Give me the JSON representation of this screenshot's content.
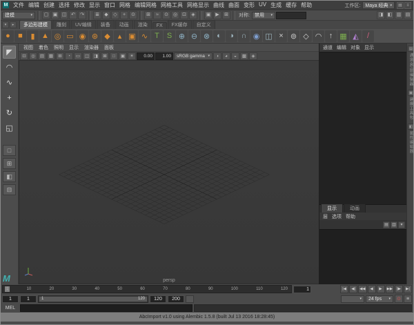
{
  "glyphs": {
    "caret": "▾"
  },
  "window": {
    "app_icon": "M",
    "workspace_label": "工作区:",
    "workspace_value": "Maya 经典",
    "right_icons": [
      {
        "name": "workspace-docking-icon",
        "glyph": "▤"
      },
      {
        "name": "workspace-menu-icon",
        "glyph": "≡"
      }
    ]
  },
  "menubar": {
    "items": [
      {
        "label": "文件"
      },
      {
        "label": "编辑"
      },
      {
        "label": "创建"
      },
      {
        "label": "选择"
      },
      {
        "label": "修改"
      },
      {
        "label": "显示"
      },
      {
        "label": "窗口"
      },
      {
        "label": "网格"
      },
      {
        "label": "编辑网格"
      },
      {
        "label": "网格工具"
      },
      {
        "label": "网格显示"
      },
      {
        "label": "曲线"
      },
      {
        "label": "曲面"
      },
      {
        "label": "变形"
      },
      {
        "label": "UV"
      },
      {
        "label": "生成"
      },
      {
        "label": "缓存"
      },
      {
        "label": "帮助"
      }
    ]
  },
  "statusline": {
    "menuset": "建模",
    "file_icons": [
      {
        "name": "new-scene-icon",
        "glyph": "▢"
      },
      {
        "name": "open-scene-icon",
        "glyph": "▣"
      },
      {
        "name": "save-scene-icon",
        "glyph": "◫"
      }
    ],
    "history_icons": [
      {
        "name": "undo-icon",
        "glyph": "↶"
      },
      {
        "name": "redo-icon",
        "glyph": "↷"
      }
    ],
    "select_icons": [
      {
        "name": "select-hierarchy-icon",
        "glyph": "≣"
      },
      {
        "name": "select-object-icon",
        "glyph": "◆"
      },
      {
        "name": "select-component-icon",
        "glyph": "◇"
      },
      {
        "name": "select-mask-handles-icon",
        "glyph": "+"
      },
      {
        "name": "select-mask-points-icon",
        "glyph": "⊙"
      }
    ],
    "snap_icons": [
      {
        "name": "snap-grid-icon",
        "glyph": "⊞"
      },
      {
        "name": "snap-curve-icon",
        "glyph": "≈"
      },
      {
        "name": "snap-point-icon",
        "glyph": "⊙"
      },
      {
        "name": "snap-projected-center-icon",
        "glyph": "◎"
      },
      {
        "name": "snap-view-plane-icon",
        "glyph": "⊡"
      },
      {
        "name": "make-live-icon",
        "glyph": "◈"
      }
    ],
    "symmetry_label": "对称:",
    "symmetry_value": "禁用",
    "input_line_value": "",
    "render_icons": [
      {
        "name": "render-frame-icon",
        "glyph": "▣"
      },
      {
        "name": "ipr-render-icon",
        "glyph": "▶"
      },
      {
        "name": "render-settings-icon",
        "glyph": "⊞"
      }
    ],
    "panel_toggle_icons": [
      {
        "name": "toggle-attribute-editor-icon",
        "glyph": "◨"
      },
      {
        "name": "toggle-tool-settings-icon",
        "glyph": "◧"
      },
      {
        "name": "toggle-channel-box-icon",
        "glyph": "▥"
      },
      {
        "name": "toggle-outliner-icon",
        "glyph": "▤"
      }
    ]
  },
  "shelf": {
    "controls": [
      {
        "name": "shelf-menu-icon",
        "glyph": "▾"
      },
      {
        "name": "shelf-tabs-icon",
        "glyph": "▸"
      }
    ],
    "tabs": [
      {
        "label": "多边形建模",
        "active": true
      },
      {
        "label": "雕刻"
      },
      {
        "label": "UV编辑"
      },
      {
        "label": "装备"
      },
      {
        "label": "动画"
      },
      {
        "label": "渲染"
      },
      {
        "label": "FX"
      },
      {
        "label": "FX缓存"
      },
      {
        "label": "自定义"
      }
    ],
    "icons": [
      {
        "name": "shelf-poly-sphere",
        "glyph": "●",
        "color": "#d98c33"
      },
      {
        "name": "shelf-poly-cube",
        "glyph": "■",
        "color": "#d98c33"
      },
      {
        "name": "shelf-poly-cylinder",
        "glyph": "▮",
        "color": "#d98c33"
      },
      {
        "name": "shelf-poly-cone",
        "glyph": "▲",
        "color": "#d98c33"
      },
      {
        "name": "shelf-poly-torus",
        "glyph": "◎",
        "color": "#d98c33"
      },
      {
        "name": "shelf-poly-plane",
        "glyph": "▭",
        "color": "#d98c33"
      },
      {
        "name": "shelf-poly-disc",
        "glyph": "◉",
        "color": "#d98c33"
      },
      {
        "name": "shelf-poly-gear",
        "glyph": "⊛",
        "color": "#d98c33"
      },
      {
        "name": "shelf-poly-platonic",
        "glyph": "◆",
        "color": "#d98c33"
      },
      {
        "name": "shelf-poly-pyramid",
        "glyph": "▴",
        "color": "#d98c33"
      },
      {
        "name": "shelf-poly-pipe",
        "glyph": "▣",
        "color": "#d98c33"
      },
      {
        "name": "shelf-poly-helix",
        "glyph": "∿",
        "color": "#d98c33"
      },
      {
        "name": "shelf-type-tool",
        "glyph": "T",
        "color": "#7cae4e"
      },
      {
        "name": "shelf-svg-tool",
        "glyph": "S",
        "color": "#7cae4e"
      },
      {
        "name": "shelf-combine",
        "glyph": "⊕",
        "color": "#8fb3c6"
      },
      {
        "name": "shelf-separate",
        "glyph": "⊖",
        "color": "#8fb3c6"
      },
      {
        "name": "shelf-extract",
        "glyph": "⊗",
        "color": "#8fb3c6"
      },
      {
        "name": "shelf-boolean-union",
        "glyph": "◐",
        "color": "#9fb6bf"
      },
      {
        "name": "shelf-boolean-difference",
        "glyph": "◑",
        "color": "#9fb6bf"
      },
      {
        "name": "shelf-boolean-intersection",
        "glyph": "∩",
        "color": "#9fb6bf"
      },
      {
        "name": "shelf-smooth",
        "glyph": "◉",
        "color": "#7f9fd0"
      },
      {
        "name": "shelf-mirror",
        "glyph": "◫",
        "color": "#9fb6bf"
      },
      {
        "name": "shelf-multi-cut",
        "glyph": "×",
        "color": "#cccccc"
      },
      {
        "name": "shelf-target-weld",
        "glyph": "⊚",
        "color": "#cccccc"
      },
      {
        "name": "shelf-bevel",
        "glyph": "◇",
        "color": "#cccccc"
      },
      {
        "name": "shelf-bridge",
        "glyph": "◠",
        "color": "#cccccc"
      },
      {
        "name": "shelf-extrude",
        "glyph": "↑",
        "color": "#cccccc"
      },
      {
        "name": "shelf-quad-draw",
        "glyph": "▦",
        "color": "#7cae4e"
      },
      {
        "name": "shelf-sculpt-tool",
        "glyph": "◭",
        "color": "#b07fd0"
      },
      {
        "name": "shelf-paint-tool",
        "glyph": "/",
        "color": "#d0607f"
      }
    ]
  },
  "toolbox": {
    "tools": [
      {
        "name": "select-tool",
        "glyph": "◤",
        "active": true
      },
      {
        "name": "lasso-select-tool",
        "glyph": "◠"
      },
      {
        "name": "paint-select-tool",
        "glyph": "∿"
      },
      {
        "name": "move-tool",
        "glyph": "+"
      },
      {
        "name": "rotate-tool",
        "glyph": "↻"
      },
      {
        "name": "scale-tool",
        "glyph": "◱"
      }
    ],
    "layout_buttons": [
      {
        "name": "layout-single-pane-button",
        "glyph": "□"
      },
      {
        "name": "layout-four-pane-button",
        "glyph": "⊞"
      },
      {
        "name": "layout-persp-outliner-button",
        "glyph": "◧"
      },
      {
        "name": "layout-persp-graph-button",
        "glyph": "⊟"
      }
    ]
  },
  "viewport": {
    "panel_menus": [
      {
        "label": "视图"
      },
      {
        "label": "着色"
      },
      {
        "label": "照明"
      },
      {
        "label": "显示"
      },
      {
        "label": "渲染器"
      },
      {
        "label": "面板"
      }
    ],
    "toolbar_icons_a": [
      {
        "name": "vp-lock-camera-icon",
        "glyph": "⊡"
      },
      {
        "name": "vp-camera-attributes-icon",
        "glyph": "◎"
      },
      {
        "name": "vp-bookmark-icon",
        "glyph": "▤"
      },
      {
        "name": "vp-image-plane-icon",
        "glyph": "▦"
      },
      {
        "name": "vp-2d-pan-zoom-icon",
        "glyph": "⊞"
      },
      {
        "name": "vp-oversampling-icon",
        "glyph": "◔"
      },
      {
        "name": "vp-film-gate-icon",
        "glyph": "▭"
      },
      {
        "name": "vp-resolution-gate-icon",
        "glyph": "◫"
      },
      {
        "name": "vp-gate-mask-icon",
        "glyph": "◨"
      },
      {
        "name": "vp-field-chart-icon",
        "glyph": "⊠"
      },
      {
        "name": "vp-safe-action-icon",
        "glyph": "□"
      },
      {
        "name": "vp-safe-title-icon",
        "glyph": "▣"
      },
      {
        "name": "vp-lighting-icon",
        "glyph": "☀"
      }
    ],
    "exposure": "0.00",
    "gamma": "1.00",
    "view_transform": "sRGB gamma",
    "toolbar_icons_b": [
      {
        "name": "vp-shadows-icon",
        "glyph": "◑"
      },
      {
        "name": "vp-ambient-occlusion-icon",
        "glyph": "◕"
      },
      {
        "name": "vp-motion-blur-icon",
        "glyph": "◒"
      },
      {
        "name": "vp-multisample-icon",
        "glyph": "▩"
      },
      {
        "name": "vp-isolate-select-icon",
        "glyph": "◈"
      }
    ],
    "camera_label": "persp"
  },
  "channel_box": {
    "menus": [
      {
        "label": "通道"
      },
      {
        "label": "编辑"
      },
      {
        "label": "对象"
      },
      {
        "label": "显示"
      }
    ]
  },
  "layer_editor": {
    "tabs": [
      {
        "label": "显示",
        "active": true
      },
      {
        "label": "动画"
      }
    ],
    "menus": [
      {
        "label": "层"
      },
      {
        "label": "选项"
      },
      {
        "label": "帮助"
      }
    ],
    "toolbar_icons": [
      {
        "name": "layer-new-empty-icon",
        "glyph": "▤"
      },
      {
        "name": "layer-new-from-selected-icon",
        "glyph": "▥"
      },
      {
        "name": "layer-options-icon",
        "glyph": "▾"
      }
    ]
  },
  "sidebar": {
    "tabs": [
      {
        "name": "channel-box-tab",
        "glyph": "▤",
        "label": "通道盒/层编辑器"
      },
      {
        "name": "modeling-toolkit-tab",
        "glyph": "▣",
        "label": "建模工具包"
      },
      {
        "name": "attribute-editor-tab",
        "glyph": "◧",
        "label": "属性编辑器"
      }
    ]
  },
  "timeline": {
    "ticks": [
      {
        "t": "1"
      },
      {
        "t": "10"
      },
      {
        "t": "20"
      },
      {
        "t": "30"
      },
      {
        "t": "40"
      },
      {
        "t": "50"
      },
      {
        "t": "60"
      },
      {
        "t": "70"
      },
      {
        "t": "80"
      },
      {
        "t": "90"
      },
      {
        "t": "100"
      },
      {
        "t": "110"
      },
      {
        "t": "120"
      }
    ],
    "current_frame": "1",
    "playback_buttons": [
      {
        "name": "go-to-start-button",
        "glyph": "|◀"
      },
      {
        "name": "step-back-frame-button",
        "glyph": "◀|"
      },
      {
        "name": "prev-key-button",
        "glyph": "◀◀"
      },
      {
        "name": "play-backwards-button",
        "glyph": "◀"
      },
      {
        "name": "play-forwards-button",
        "glyph": "▶"
      },
      {
        "name": "next-key-button",
        "glyph": "▶▶"
      },
      {
        "name": "step-forward-frame-button",
        "glyph": "|▶"
      },
      {
        "name": "go-to-end-button",
        "glyph": "▶|"
      }
    ]
  },
  "range": {
    "anim_start": "1",
    "playback_start": "1",
    "slider_start": "1",
    "slider_end": "120",
    "playback_end": "120",
    "anim_end": "200",
    "character_set_value": "",
    "fps_value": "24 fps",
    "buttons": [
      {
        "name": "auto-key-icon",
        "glyph": "⊙",
        "color": "#d05454"
      },
      {
        "name": "animation-preferences-icon",
        "glyph": "≡"
      }
    ]
  },
  "command_line": {
    "label": "MEL",
    "value": ""
  },
  "help_line": {
    "text": "AbcImport v1.0 using Alembic 1.5.8 (built Jul 13 2016 18:28:45)"
  },
  "colors": {
    "viewport_background": "#3a3a3a",
    "grid_line": "#2e2e2e",
    "grid_axis": "#1f1f1f",
    "shelf_primitive_orange": "#d98c33",
    "maya_logo_teal": "#43b1b1",
    "help_bar_gray": "#7d7d7d"
  }
}
